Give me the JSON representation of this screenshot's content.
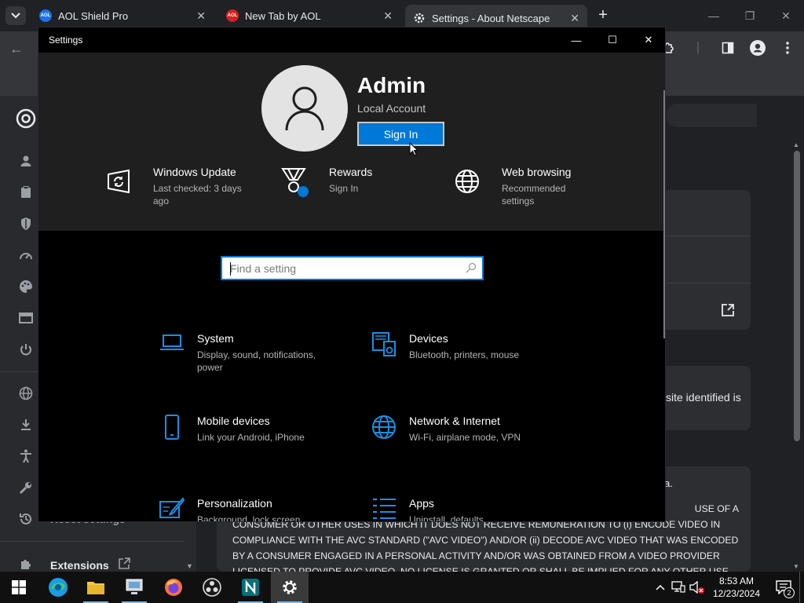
{
  "browser": {
    "tabs": [
      {
        "title": "AOL Shield Pro",
        "favicon": "aol-shield-icon",
        "active": false
      },
      {
        "title": "New Tab by AOL",
        "favicon": "aol-icon",
        "active": false
      },
      {
        "title": "Settings - About Netscape",
        "favicon": "gear-icon",
        "active": true
      }
    ],
    "rail": {
      "extensions_label": "Extensions",
      "reset_label": "Reset settings"
    },
    "page": {
      "partial_text_1": "site identified is",
      "partial_text_2": "a.",
      "license_lines": [
        "USE OF A",
        "CONSUMER OR OTHER USES IN WHICH IT DOES NOT RECEIVE REMUNERATION TO (i) ENCODE VIDEO IN",
        "COMPLIANCE WITH THE AVC STANDARD (\"AVC VIDEO\") AND/OR (ii) DECODE AVC VIDEO THAT WAS ENCODED",
        "BY A CONSUMER ENGAGED IN A PERSONAL ACTIVITY AND/OR WAS OBTAINED FROM A VIDEO PROVIDER",
        "LICENSED TO PROVIDE AVC VIDEO. NO LICENSE IS GRANTED OR SHALL BE IMPLIED FOR ANY OTHER USE."
      ]
    }
  },
  "settings_window": {
    "title": "Settings",
    "account": {
      "name": "Admin",
      "type": "Local Account",
      "signin_label": "Sign In"
    },
    "quick_links": [
      {
        "title": "Windows Update",
        "subtitle": "Last checked: 3 days ago",
        "icon": "windows-update-icon"
      },
      {
        "title": "Rewards",
        "subtitle": "Sign In",
        "icon": "rewards-medal-icon"
      },
      {
        "title": "Web browsing",
        "subtitle": "Recommended settings",
        "icon": "globe-icon"
      }
    ],
    "search": {
      "placeholder": "Find a setting"
    },
    "categories": [
      {
        "title": "System",
        "subtitle": "Display, sound, notifications, power",
        "icon": "laptop-icon"
      },
      {
        "title": "Devices",
        "subtitle": "Bluetooth, printers, mouse",
        "icon": "devices-icon"
      },
      {
        "title": "Mobile devices",
        "subtitle": "Link your Android, iPhone",
        "icon": "phone-icon"
      },
      {
        "title": "Network & Internet",
        "subtitle": "Wi-Fi, airplane mode, VPN",
        "icon": "network-globe-icon"
      },
      {
        "title": "Personalization",
        "subtitle": "Background, lock screen, colors",
        "icon": "personalization-icon"
      },
      {
        "title": "Apps",
        "subtitle": "Uninstall, defaults",
        "icon": "apps-list-icon"
      }
    ],
    "accent_color": "#0078d7"
  },
  "taskbar": {
    "time": "8:53 AM",
    "date": "12/23/2024",
    "notification_count": "2"
  }
}
